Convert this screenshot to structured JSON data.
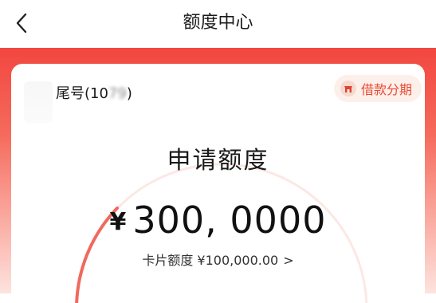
{
  "header": {
    "title": "额度中心"
  },
  "account": {
    "prefix": "尾号(10",
    "masked": "79",
    "suffix": ")"
  },
  "badge": {
    "label": "借款分期",
    "icon": "store-icon",
    "color": "#ea4a33"
  },
  "gauge": {
    "title": "申请额度",
    "currency": "¥",
    "amount": "300, 0000"
  },
  "card_limit": {
    "label": "卡片额度 ¥100,000.00",
    "chevron": ">"
  },
  "colors": {
    "accent": "#f2473f",
    "badge_bg": "#fdf0ea",
    "arc_active": "#ef5350"
  }
}
